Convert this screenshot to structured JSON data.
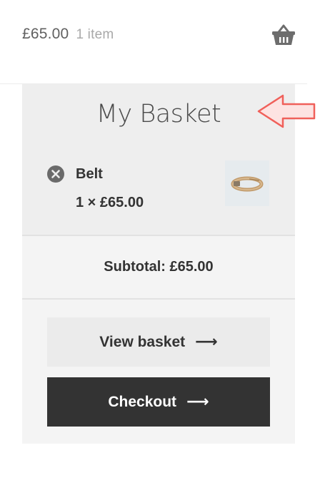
{
  "header": {
    "cart_total": "£65.00",
    "cart_count": "1 item",
    "icon": "basket-icon"
  },
  "mini_cart": {
    "title": "My Basket",
    "items": [
      {
        "name": "Belt",
        "quantity_price": "1 × £65.00",
        "remove_icon": "remove-icon",
        "thumbnail": "belt-image"
      }
    ],
    "subtotal": "Subtotal: £65.00",
    "buttons": {
      "view_basket": "View basket",
      "checkout": "Checkout",
      "arrow": "⟶",
      "arrow_icon": "right-arrow-icon"
    }
  },
  "annotation": {
    "icon": "pointer-arrow-icon",
    "color": "#f0605a"
  },
  "colors": {
    "panel_bg": "#f4f4f4",
    "item_bg": "#eeeeee",
    "checkout_bg": "#333333",
    "view_bg": "#ebebeb"
  }
}
